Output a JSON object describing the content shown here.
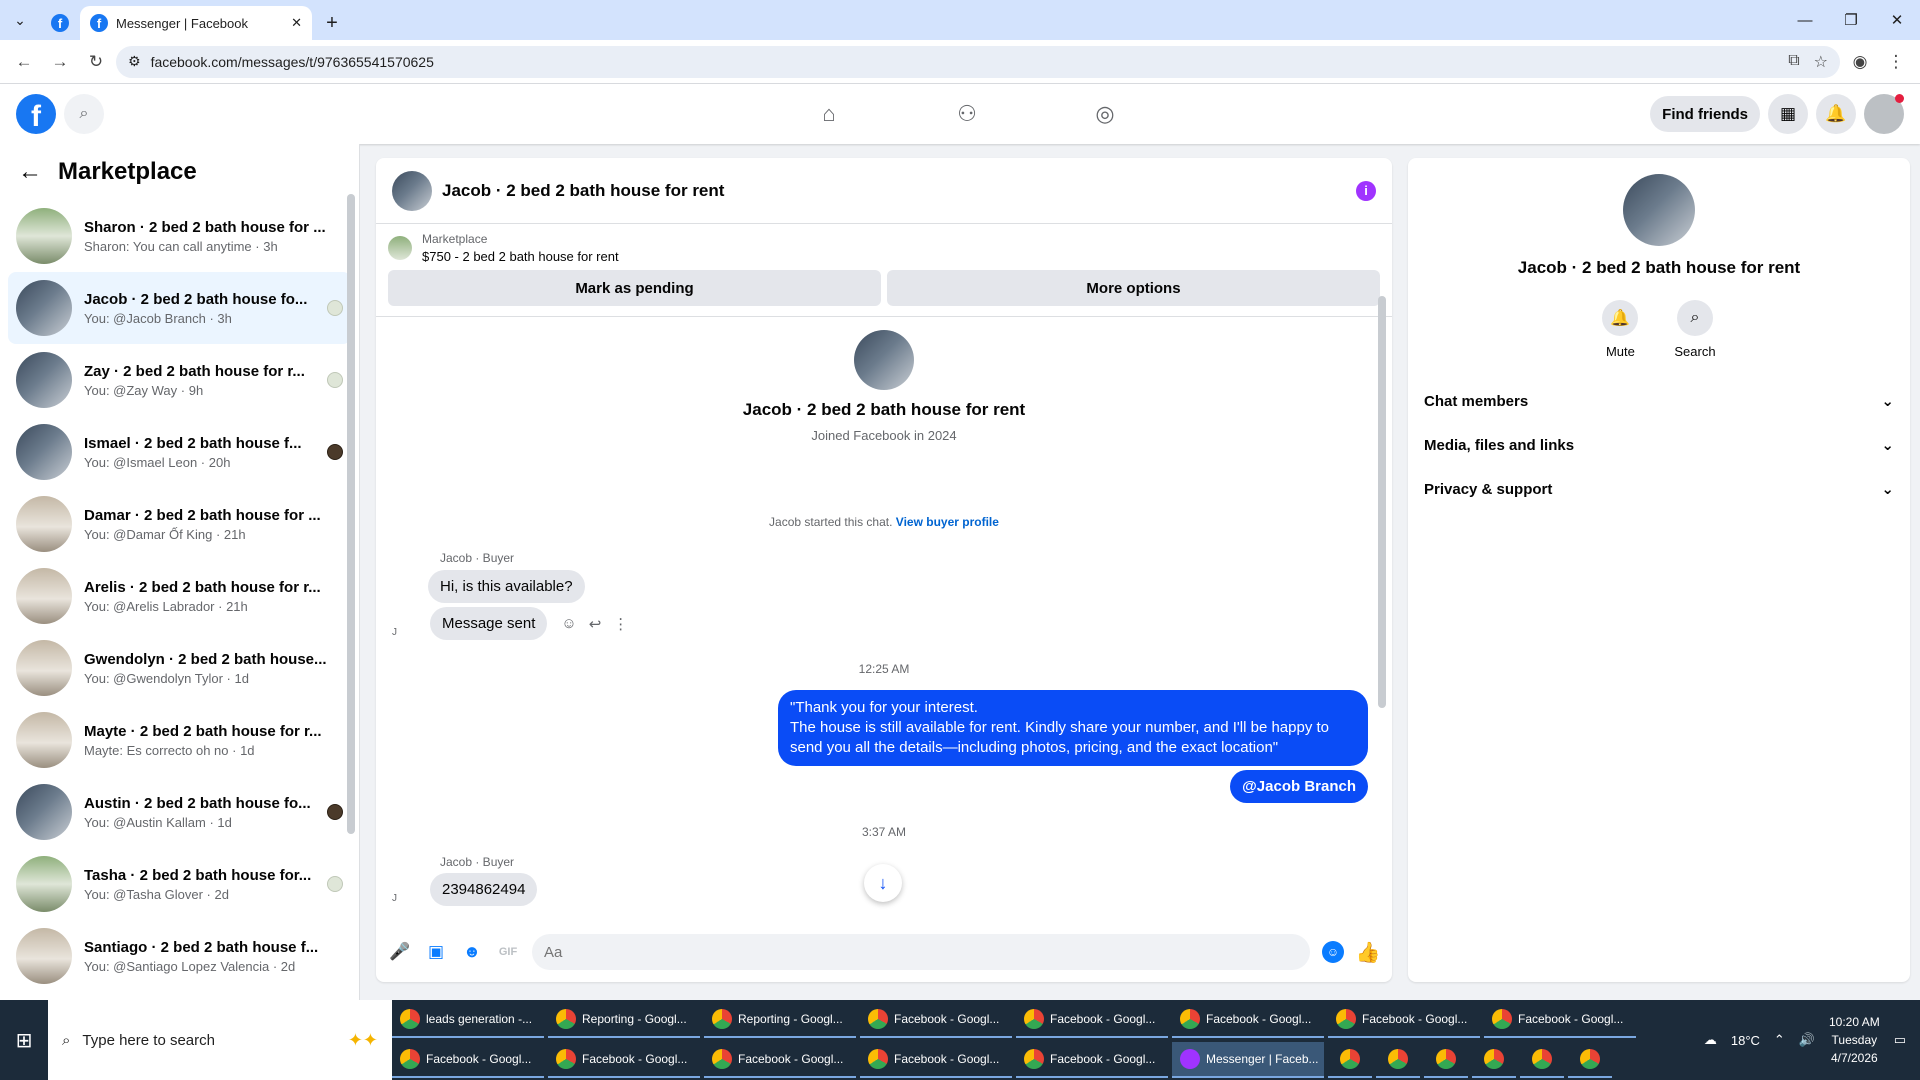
{
  "browser": {
    "tab_title": "Messenger | Facebook",
    "url": "facebook.com/messages/t/976365541570625"
  },
  "header": {
    "find_friends": "Find friends"
  },
  "sidebar": {
    "title": "Marketplace",
    "conversations": [
      {
        "name": "Sharon · 2 bed 2 bath house for ...",
        "sub": "Sharon: You can call anytime · 3h",
        "avatar": "av-c",
        "seen": ""
      },
      {
        "name": "Jacob · 2 bed 2 bath house fo...",
        "sub": "You: @Jacob Branch · 3h",
        "avatar": "av-a",
        "seen": "light",
        "active": true
      },
      {
        "name": "Zay · 2 bed 2 bath house for r...",
        "sub": "You: @Zay Way · 9h",
        "avatar": "av-a",
        "seen": "light"
      },
      {
        "name": "Ismael · 2 bed 2 bath house f...",
        "sub": "You: @Ismael Leon · 20h",
        "avatar": "av-a",
        "seen": "dark"
      },
      {
        "name": "Damar · 2 bed 2 bath house for ...",
        "sub": "You: @Damar Ốf King · 21h",
        "avatar": "av-b",
        "seen": ""
      },
      {
        "name": "Arelis · 2 bed 2 bath house for r...",
        "sub": "You: @Arelis Labrador · 21h",
        "avatar": "av-b",
        "seen": ""
      },
      {
        "name": "Gwendolyn · 2 bed 2 bath house...",
        "sub": "You: @Gwendolyn Tylor · 1d",
        "avatar": "av-b",
        "seen": ""
      },
      {
        "name": "Mayte · 2 bed 2 bath house for r...",
        "sub": "Mayte: Es correcto oh no · 1d",
        "avatar": "av-b",
        "seen": ""
      },
      {
        "name": "Austin · 2 bed 2 bath house fo...",
        "sub": "You: @Austin Kallam · 1d",
        "avatar": "av-a",
        "seen": "dark"
      },
      {
        "name": "Tasha · 2 bed 2 bath house for...",
        "sub": "You: @Tasha Glover · 2d",
        "avatar": "av-c",
        "seen": "light"
      },
      {
        "name": "Santiago · 2 bed 2 bath house f...",
        "sub": "You: @Santiago Lopez Valencia · 2d",
        "avatar": "av-b",
        "seen": ""
      }
    ]
  },
  "chat": {
    "title": "Jacob · 2 bed 2 bath house for rent",
    "listing_label": "Marketplace",
    "listing_detail": "$750 - 2 bed 2 bath house for rent",
    "mark_pending": "Mark as pending",
    "more_options": "More options",
    "intro_name": "Jacob · 2 bed 2 bath house for rent",
    "intro_sub": "Joined Facebook in 2024",
    "started_text": "Jacob started this chat.",
    "view_profile": "View buyer profile",
    "sender_label": "Jacob · Buyer",
    "msg1": "Hi, is this available?",
    "msg2": "Message sent",
    "time1": "12:25 AM",
    "out_msg_line1": "\"Thank you for your interest.",
    "out_msg_line2": "The house is still available for rent. Kindly share your number, and I'll be happy to send you all the details—including photos, pricing, and the exact location\"",
    "out_mention": "@Jacob Branch",
    "time2": "3:37 AM",
    "sender_label2": "Jacob · Buyer",
    "msg3": "2394862494",
    "composer_placeholder": "Aa"
  },
  "rpanel": {
    "name": "Jacob · 2 bed 2 bath house for rent",
    "mute": "Mute",
    "search": "Search",
    "sections": [
      "Chat members",
      "Media, files and links",
      "Privacy & support"
    ]
  },
  "taskbar": {
    "search_placeholder": "Type here to search",
    "row1": [
      "leads generation -...",
      "Reporting - Googl...",
      "Reporting - Googl...",
      "Facebook - Googl...",
      "Facebook - Googl...",
      "Facebook - Googl...",
      "Facebook - Googl...",
      "Facebook - Googl..."
    ],
    "row2": [
      "Facebook - Googl...",
      "Facebook - Googl...",
      "Facebook - Googl...",
      "Facebook - Googl...",
      "Facebook - Googl...",
      "Messenger | Faceb..."
    ],
    "temp": "18°C",
    "time": "10:20 AM",
    "day": "Tuesday",
    "date": "4/7/2026"
  }
}
